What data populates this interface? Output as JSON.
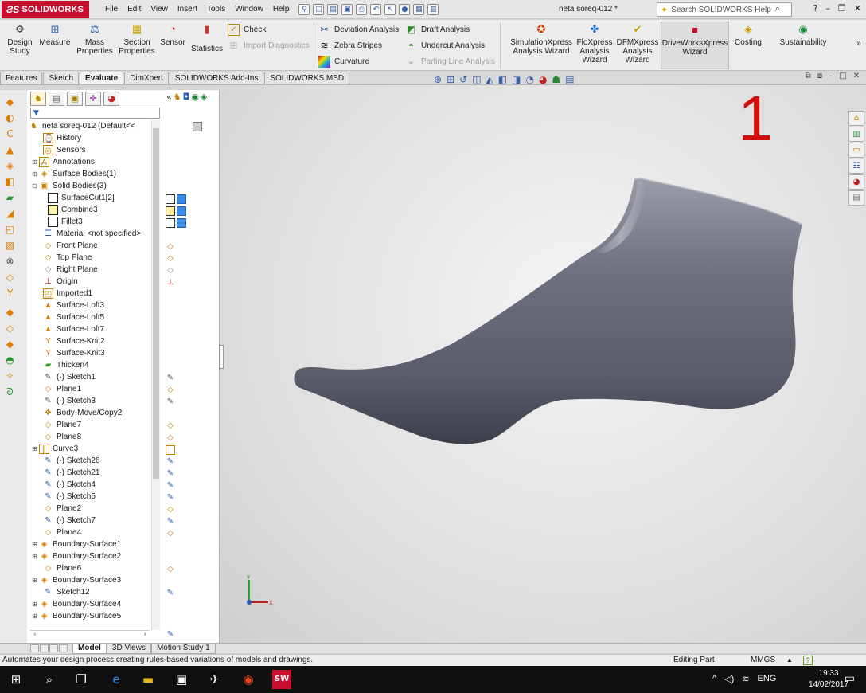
{
  "titlebar": {
    "brand": "SOLIDWORKS",
    "menu": [
      "File",
      "Edit",
      "View",
      "Insert",
      "Tools",
      "Window",
      "Help"
    ],
    "document_title": "neta soreq-012 *",
    "search_placeholder": "Search SOLIDWORKS Help"
  },
  "command_manager": {
    "design_study": "Design Study",
    "measure": "Measure",
    "mass_properties": "Mass Properties",
    "section_properties": "Section Properties",
    "sensor": "Sensor",
    "statistics": "Statistics",
    "check": "Check",
    "import_diagnostics": "Import Diagnostics",
    "deviation_analysis": "Deviation Analysis",
    "zebra_stripes": "Zebra Stripes",
    "curvature": "Curvature",
    "draft_analysis": "Draft Analysis",
    "undercut_analysis": "Undercut Analysis",
    "parting_line_analysis": "Parting Line Analysis",
    "simulationxpress": "SimulationXpress Analysis Wizard",
    "floxpress": "FloXpress Analysis Wizard",
    "dfmxpress": "DFMXpress Analysis Wizard",
    "driveworksxpress": "DriveWorksXpress Wizard",
    "costing": "Costing",
    "sustainability": "Sustainability"
  },
  "tabs": [
    "Features",
    "Sketch",
    "Evaluate",
    "DimXpert",
    "SOLIDWORKS Add-Ins",
    "SOLIDWORKS MBD"
  ],
  "feature_tree": {
    "root": "neta soreq-012  (Default<<",
    "items": [
      "History",
      "Sensors",
      "Annotations",
      "Surface Bodies(1)",
      "Solid Bodies(3)",
      "SurfaceCut1[2]",
      "Combine3",
      "Fillet3",
      "Material <not specified>",
      "Front Plane",
      "Top Plane",
      "Right Plane",
      "Origin",
      "Imported1",
      "Surface-Loft3",
      "Surface-Loft5",
      "Surface-Loft7",
      "Surface-Knit2",
      "Surface-Knit3",
      "Thicken4",
      "(-) Sketch1",
      "Plane1",
      "(-) Sketch3",
      "Body-Move/Copy2",
      "Plane7",
      "Plane8",
      "Curve3",
      "(-) Sketch26",
      "(-) Sketch21",
      "(-) Sketch4",
      "(-) Sketch5",
      "Plane2",
      "(-) Sketch7",
      "Plane4",
      "Boundary-Surface1",
      "Boundary-Surface2",
      "Plane6",
      "Boundary-Surface3",
      "Sketch12",
      "Boundary-Surface4",
      "Boundary-Surface5"
    ]
  },
  "viewport": {
    "overlay_number": "1"
  },
  "model_tabs": [
    "Model",
    "3D Views",
    "Motion Study 1"
  ],
  "statusbar": {
    "message": "Automates your design process creating rules-based variations of models and drawings.",
    "mode": "Editing Part",
    "units": "MMGS"
  },
  "taskbar": {
    "language": "ENG",
    "time": "19:33",
    "date": "14/02/2017"
  },
  "colors": {
    "brand_red": "#c8102e",
    "model_gray": "#5f6170",
    "overlay_red": "#d0100c"
  }
}
